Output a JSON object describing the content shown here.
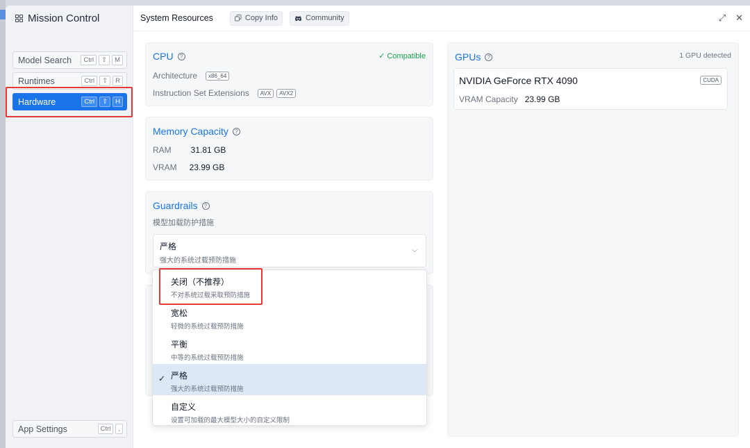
{
  "sidebar": {
    "title": "Mission Control",
    "items": [
      {
        "label": "Model Search",
        "keys": [
          "Ctrl",
          "⇧",
          "M"
        ]
      },
      {
        "label": "Runtimes",
        "keys": [
          "Ctrl",
          "⇧",
          "R"
        ]
      },
      {
        "label": "Hardware",
        "keys": [
          "Ctrl",
          "⇧",
          "H"
        ]
      }
    ],
    "settings": {
      "label": "App Settings",
      "keys": [
        "Ctrl",
        ","
      ]
    }
  },
  "topbar": {
    "title": "System Resources",
    "copy_label": "Copy Info",
    "community_label": "Community"
  },
  "cpu": {
    "title": "CPU",
    "status": "✓ Compatible",
    "arch_label": "Architecture",
    "arch_value": "x86_64",
    "ext_label": "Instruction Set Extensions",
    "extensions": [
      "AVX",
      "AVX2"
    ]
  },
  "memory": {
    "title": "Memory Capacity",
    "ram_label": "RAM",
    "ram_value": "31.81 GB",
    "vram_label": "VRAM",
    "vram_value": "23.99 GB"
  },
  "guardrails": {
    "title": "Guardrails",
    "subtitle": "模型加载防护措施",
    "selected_main": "严格",
    "selected_sub": "强大的系统过载预防措施",
    "options": [
      {
        "main": "关闭（不推荐）",
        "sub": "不对系统过载采取预防措施"
      },
      {
        "main": "宽松",
        "sub": "轻微的系统过载预防措施"
      },
      {
        "main": "平衡",
        "sub": "中等的系统过载预防措施"
      },
      {
        "main": "严格",
        "sub": "强大的系统过载预防措施"
      },
      {
        "main": "自定义",
        "sub": "设置可加载的最大模型大小的自定义限制"
      }
    ]
  },
  "gpus": {
    "title": "GPUs",
    "count": "1 GPU detected",
    "name": "NVIDIA GeForce RTX 4090",
    "badge": "CUDA",
    "vram_label": "VRAM Capacity",
    "vram_value": "23.99 GB"
  },
  "colors": {
    "accent": "#1a73e8",
    "highlight": "#e53935",
    "compatible": "#16a34a"
  },
  "icons": [
    "grid-icon",
    "copy-icon",
    "discord-icon",
    "help-icon",
    "expand-icon",
    "close-icon",
    "chevron-down-icon",
    "check-icon"
  ]
}
